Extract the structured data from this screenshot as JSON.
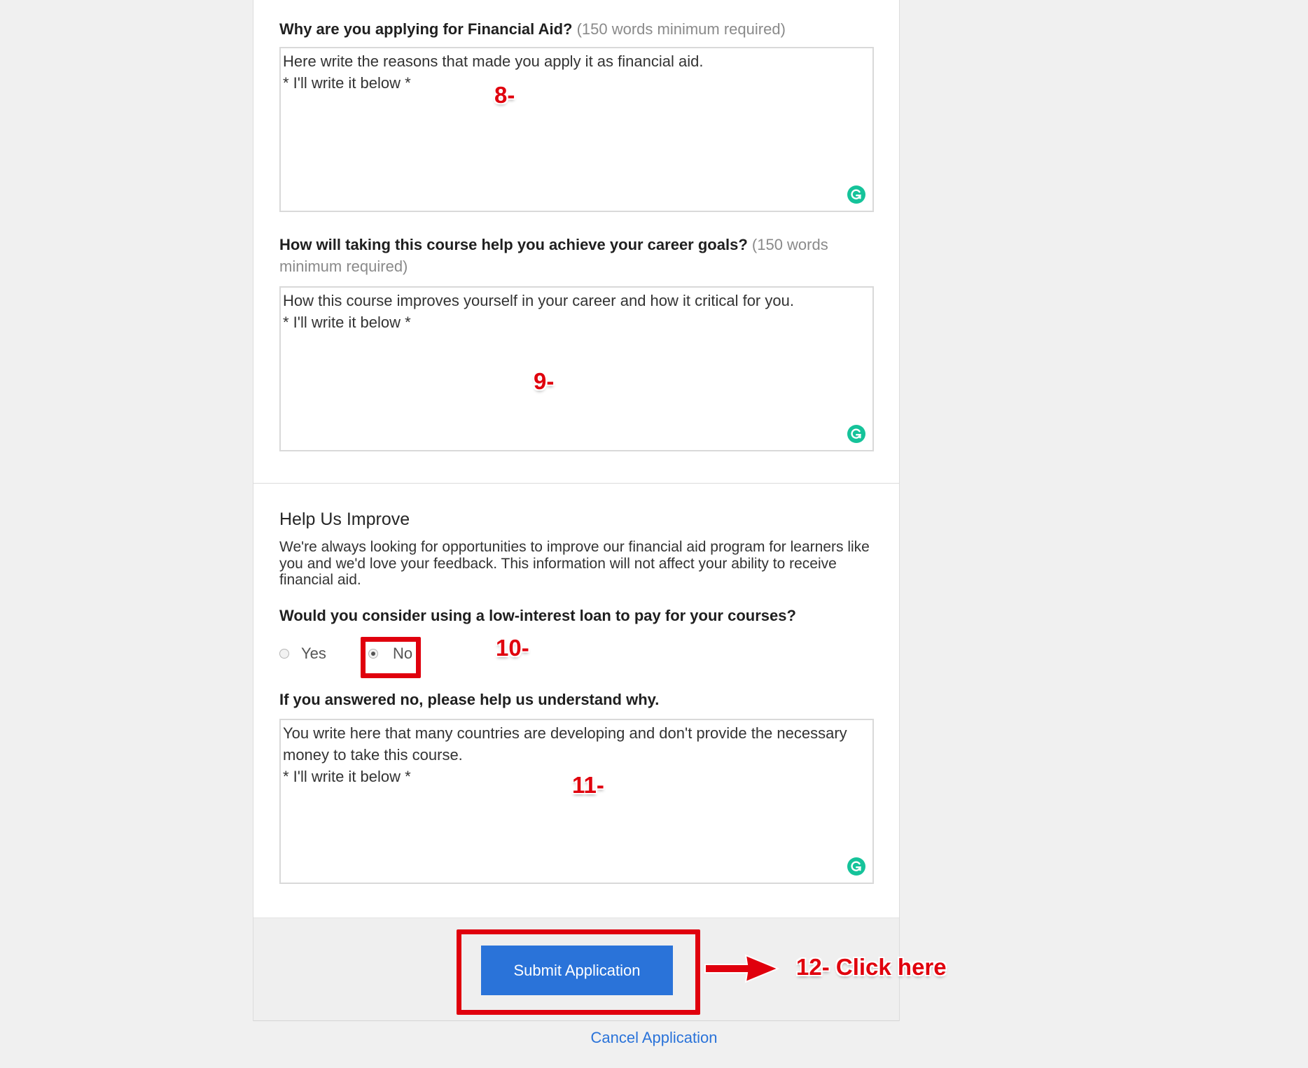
{
  "questions": {
    "q1": {
      "label": "Why are you applying for Financial Aid?",
      "hint": "(150 words minimum required)",
      "line1": "Here write the reasons that made you apply it as financial aid.",
      "line2": "* I'll write it below *"
    },
    "q2": {
      "label": "How will taking this course help you achieve your career goals?",
      "hint": "(150 words minimum required)",
      "line1": "How this course improves yourself in your career and how it critical for you.",
      "line2": "* I'll write it below *"
    }
  },
  "help": {
    "title": "Help Us Improve",
    "description": "We're always looking for opportunities to improve our financial aid program for learners like you and we'd love your feedback. This information will not affect your ability to receive financial aid.",
    "loan_question": "Would you consider using a low-interest loan to pay for your courses?",
    "options": {
      "yes": "Yes",
      "no": "No",
      "selected": "No"
    },
    "why_label": "If you answered no, please help us understand why.",
    "why_line1": "You write here that many countries are developing and don't provide the necessary money to take this course.",
    "why_line2": "* I'll write it below *"
  },
  "actions": {
    "submit": "Submit Application",
    "cancel": "Cancel Application"
  },
  "annotations": {
    "a8": "8-",
    "a9": "9-",
    "a10": "10-",
    "a11": "11-",
    "a12": "12- Click here"
  },
  "colors": {
    "accent": "#2a73d9",
    "annotation_red": "#e0000d",
    "grammarly": "#15c39a"
  },
  "icons": [
    "grammarly-icon",
    "radio-unselected",
    "radio-selected",
    "arrow-right-icon"
  ]
}
